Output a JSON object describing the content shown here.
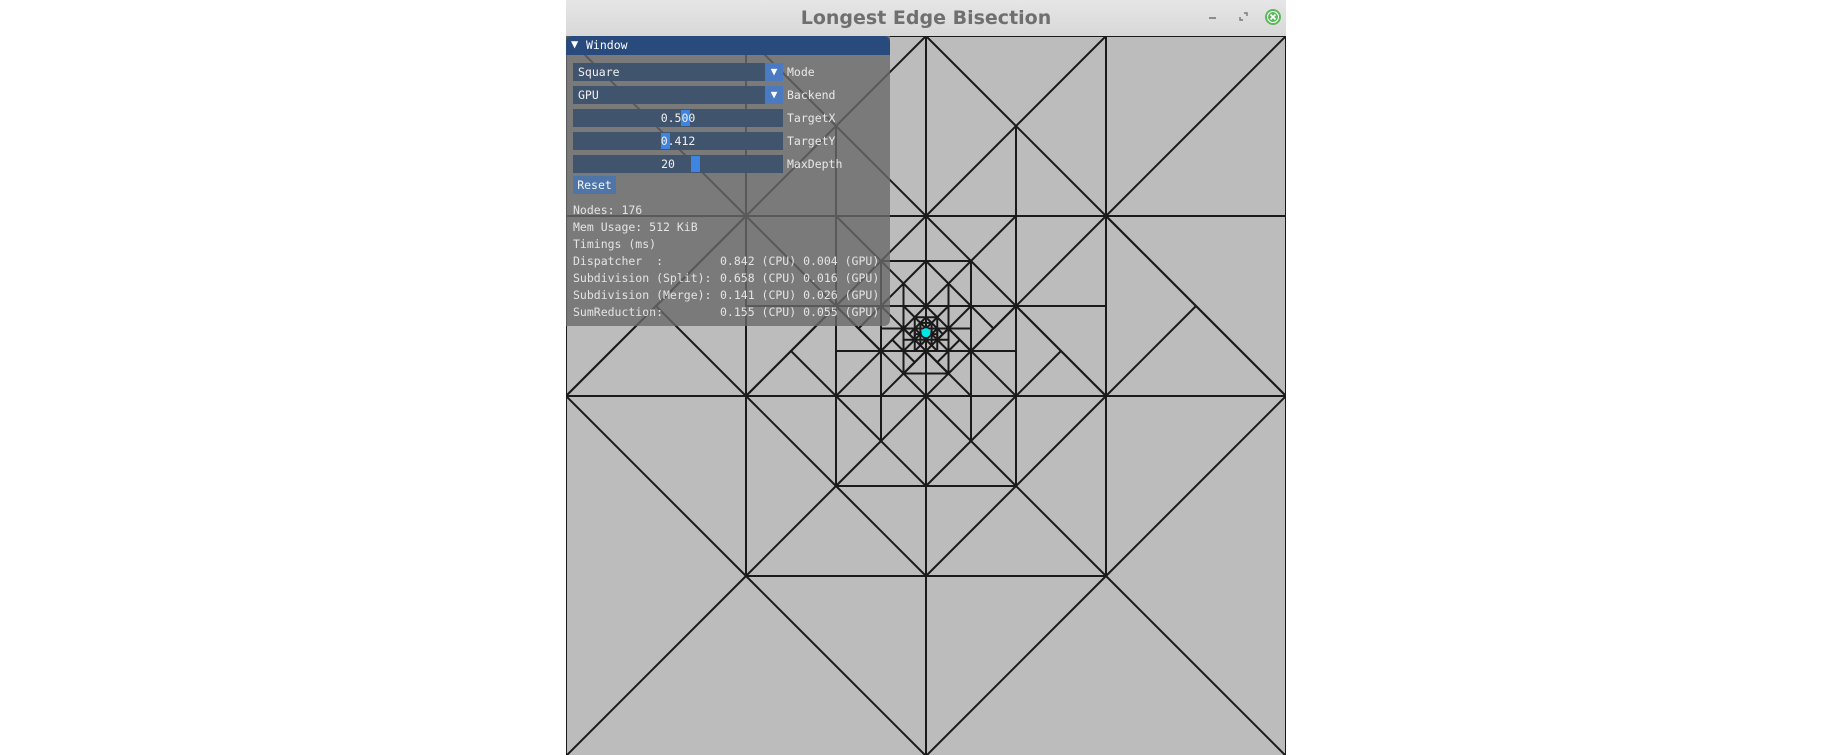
{
  "window": {
    "title": "Longest Edge Bisection"
  },
  "panel": {
    "title": "Window",
    "collapse_glyph": "▼",
    "mode": {
      "value": "Square",
      "label": "Mode"
    },
    "backend": {
      "value": "GPU",
      "label": "Backend"
    },
    "target_x": {
      "value": "0.500",
      "label": "TargetX",
      "fraction": 0.5
    },
    "target_y": {
      "value": "0.412",
      "label": "TargetY",
      "fraction": 0.412
    },
    "max_depth": {
      "value": "20",
      "label": "MaxDepth"
    },
    "reset_label": "Reset",
    "stats": {
      "nodes": "Nodes: 176",
      "mem": "Mem Usage: 512 KiB",
      "timings_header": "Timings (ms)",
      "rows": [
        {
          "label": "Dispatcher  :",
          "value": "0.842 (CPU) 0.004 (GPU)"
        },
        {
          "label": "Subdivision (Split):",
          "value": "0.658 (CPU) 0.016 (GPU)"
        },
        {
          "label": "Subdivision (Merge):",
          "value": "0.141 (CPU) 0.026 (GPU)"
        },
        {
          "label": "SumReduction:",
          "value": "0.155 (CPU) 0.055 (GPU)"
        }
      ]
    }
  },
  "colors": {
    "background": "#bcbcbc",
    "edges": "#1a1a1a",
    "target": "#00e5e5",
    "header": "#284a7c",
    "accent": "#3d85e0",
    "close_button": "#5cb85c"
  },
  "icons": [
    "minimize-icon",
    "maximize-icon",
    "close-icon",
    "chevron-down-icon"
  ]
}
